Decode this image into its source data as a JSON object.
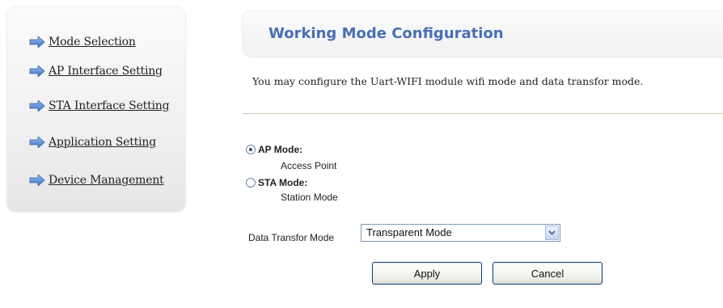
{
  "sidebar": {
    "items": [
      {
        "label": "Mode Selection",
        "icon": "arrow-right-icon"
      },
      {
        "label": "AP Interface Setting",
        "icon": "arrow-right-icon"
      },
      {
        "label": "STA Interface Setting",
        "icon": "arrow-right-icon"
      },
      {
        "label": "Application Setting",
        "icon": "arrow-right-icon"
      },
      {
        "label": "Device Management",
        "icon": "arrow-right-icon"
      }
    ]
  },
  "header": {
    "title": "Working Mode Configuration"
  },
  "main": {
    "description": "You may configure the Uart-WIFI module wifi mode and data transfor mode.",
    "modes": [
      {
        "label": "AP Mode:",
        "sublabel": "Access Point",
        "checked": true
      },
      {
        "label": "STA Mode:",
        "sublabel": "Station Mode",
        "checked": false
      }
    ],
    "data_transfor": {
      "label": "Data Transfor Mode",
      "selected": "Transparent Mode"
    },
    "buttons": {
      "apply": "Apply",
      "cancel": "Cancel"
    }
  },
  "colors": {
    "title": "#4a6fb4",
    "arrow": "#4f7fcf",
    "divider": "#c9c9b6"
  }
}
